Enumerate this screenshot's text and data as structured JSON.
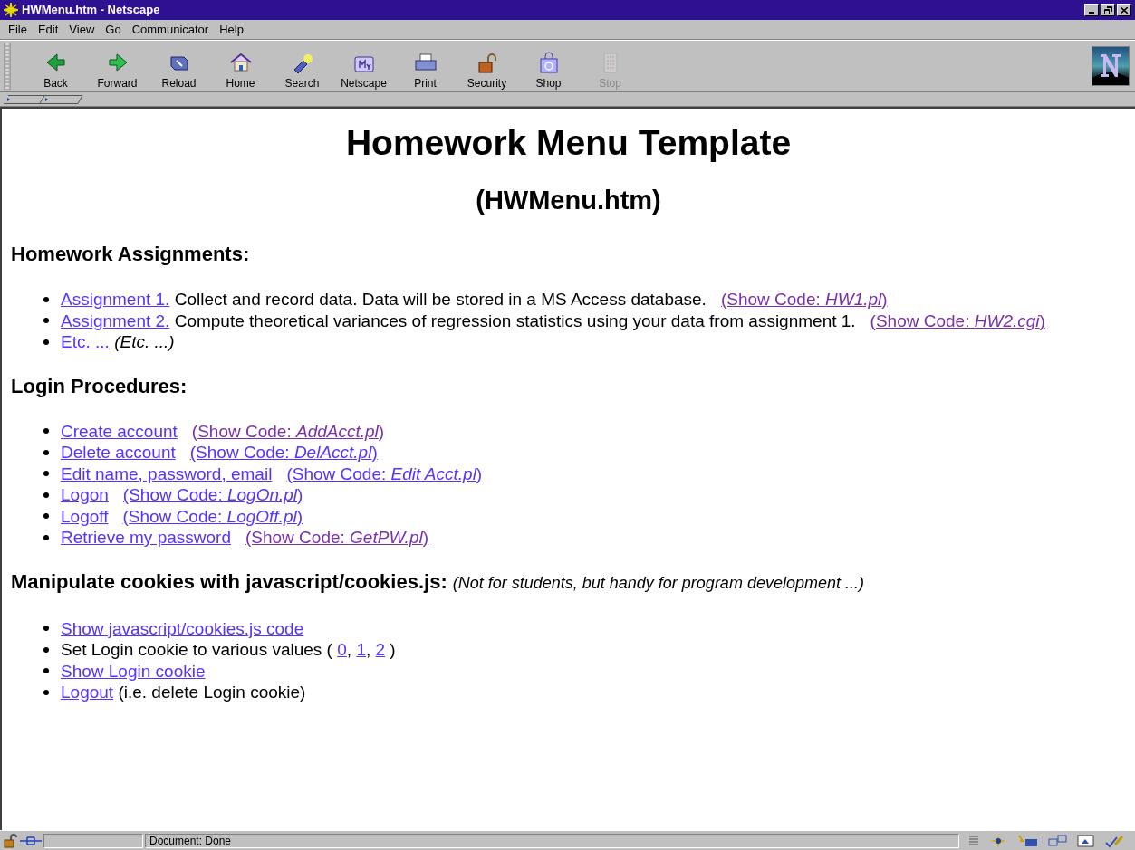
{
  "window": {
    "title": "HWMenu.htm - Netscape"
  },
  "menu": [
    "File",
    "Edit",
    "View",
    "Go",
    "Communicator",
    "Help"
  ],
  "toolbar": [
    {
      "label": "Back",
      "disabled": false
    },
    {
      "label": "Forward",
      "disabled": false
    },
    {
      "label": "Reload",
      "disabled": false
    },
    {
      "label": "Home",
      "disabled": false
    },
    {
      "label": "Search",
      "disabled": false
    },
    {
      "label": "Netscape",
      "disabled": false
    },
    {
      "label": "Print",
      "disabled": false
    },
    {
      "label": "Security",
      "disabled": false
    },
    {
      "label": "Shop",
      "disabled": false
    },
    {
      "label": "Stop",
      "disabled": true
    }
  ],
  "page": {
    "title": "Homework Menu Template",
    "subtitle": "(HWMenu.htm)",
    "sections": [
      {
        "heading": "Homework Assignments:",
        "items": [
          [
            {
              "kind": "link",
              "text": "Assignment 1.",
              "visited": false
            },
            {
              "kind": "text",
              "text": " Collect and record data. Data will be stored in a MS Access database."
            },
            {
              "kind": "code_link",
              "text": "(Show Code: *HW1.pl*)",
              "visited": true
            }
          ],
          [
            {
              "kind": "link",
              "text": "Assignment 2.",
              "visited": false
            },
            {
              "kind": "text",
              "text": " Compute theoretical variances of regression statistics using your data from assignment 1."
            },
            {
              "kind": "code_link",
              "text": "(Show Code: *HW2.cgi*)",
              "visited": true
            }
          ],
          [
            {
              "kind": "link",
              "text": "Etc. ...",
              "visited": false
            },
            {
              "kind": "italic",
              "text": " (Etc. ...)"
            }
          ]
        ]
      },
      {
        "heading": "Login Procedures:",
        "items": [
          [
            {
              "kind": "link",
              "text": "Create account",
              "visited": false
            },
            {
              "kind": "code_link",
              "text": "(Show Code: *AddAcct.pl*)",
              "visited": true
            }
          ],
          [
            {
              "kind": "link",
              "text": "Delete account",
              "visited": false
            },
            {
              "kind": "code_link",
              "text": "(Show Code: *DelAcct.pl*)",
              "visited": false
            }
          ],
          [
            {
              "kind": "link",
              "text": "Edit name, password, email",
              "visited": false
            },
            {
              "kind": "code_link",
              "text": "(Show Code: *Edit Acct.pl*)",
              "visited": false
            }
          ],
          [
            {
              "kind": "link",
              "text": "Logon",
              "visited": false
            },
            {
              "kind": "code_link",
              "text": "(Show Code: *LogOn.pl*)",
              "visited": false
            }
          ],
          [
            {
              "kind": "link",
              "text": "Logoff",
              "visited": false
            },
            {
              "kind": "code_link",
              "text": "(Show Code: *LogOff.pl*)",
              "visited": false
            }
          ],
          [
            {
              "kind": "link",
              "text": "Retrieve my password",
              "visited": false
            },
            {
              "kind": "code_link",
              "text": "(Show Code: *GetPW.pl*)",
              "visited": true
            }
          ]
        ]
      },
      {
        "heading": "Manipulate cookies with javascript/cookies.js:",
        "note": "(Not for students, but handy for program development ...)",
        "items": [
          [
            {
              "kind": "link",
              "text": "Show javascript/cookies.js code",
              "visited": false
            }
          ],
          [
            {
              "kind": "text",
              "text": "Set Login cookie to various values ( "
            },
            {
              "kind": "link",
              "text": "0",
              "visited": false
            },
            {
              "kind": "text",
              "text": ", "
            },
            {
              "kind": "link",
              "text": "1",
              "visited": false
            },
            {
              "kind": "text",
              "text": ", "
            },
            {
              "kind": "link",
              "text": "2",
              "visited": false
            },
            {
              "kind": "text",
              "text": " )"
            }
          ],
          [
            {
              "kind": "link",
              "text": "Show Login cookie",
              "visited": false
            }
          ],
          [
            {
              "kind": "link",
              "text": "Logout",
              "visited": false
            },
            {
              "kind": "text",
              "text": " (i.e. delete Login cookie)"
            }
          ]
        ]
      }
    ]
  },
  "status_bar": {
    "text": "Document: Done"
  }
}
